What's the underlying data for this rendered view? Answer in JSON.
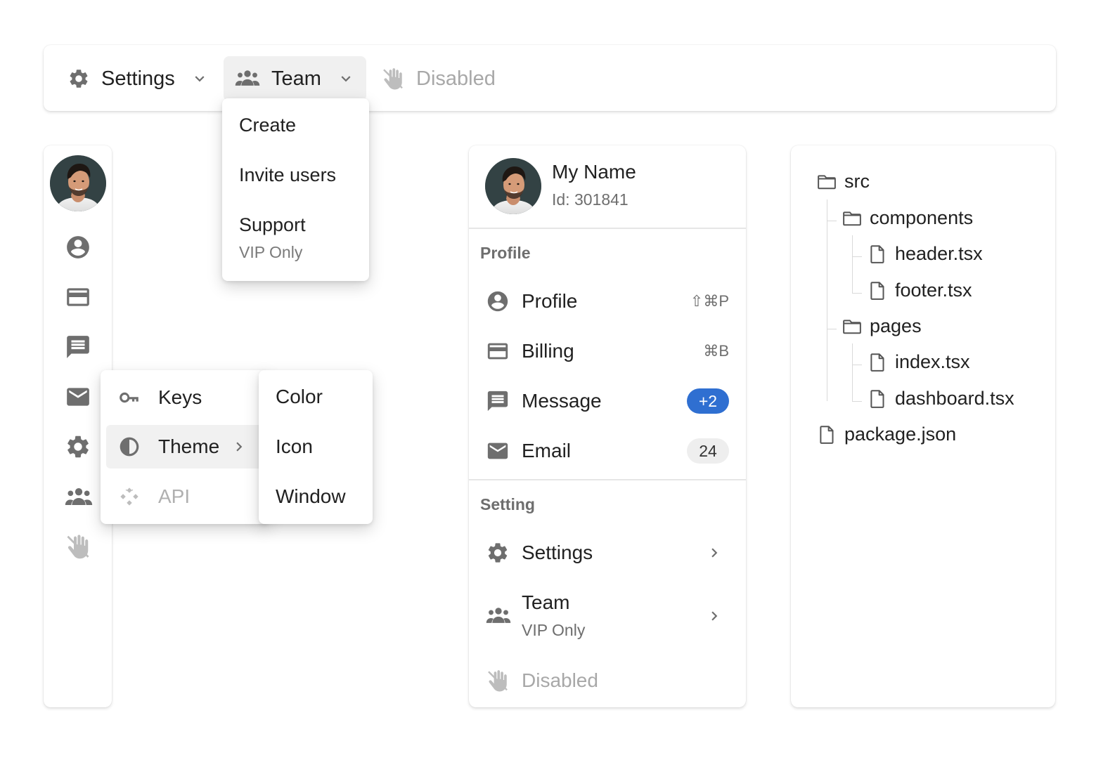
{
  "menubar": {
    "settings_label": "Settings",
    "team_label": "Team",
    "disabled_label": "Disabled"
  },
  "team_menu": {
    "items": [
      {
        "label": "Create"
      },
      {
        "label": "Invite users"
      },
      {
        "label": "Support",
        "sublabel": "VIP Only"
      }
    ]
  },
  "rail": {
    "icons": [
      "avatar",
      "account-circle-icon",
      "credit-card-icon",
      "message-icon",
      "mail-icon",
      "gear-icon",
      "team-icon",
      "disabled-hand-icon"
    ]
  },
  "keys_menu": {
    "items": [
      {
        "label": "Keys",
        "icon": "key-icon"
      },
      {
        "label": "Theme",
        "icon": "contrast-icon"
      },
      {
        "label": "API",
        "icon": "api-icon",
        "disabled": true
      }
    ],
    "theme_submenu": [
      "Color",
      "Icon",
      "Window"
    ]
  },
  "user": {
    "name": "My Name",
    "id_text": "Id: 301841"
  },
  "profile_section": {
    "title": "Profile",
    "items": [
      {
        "label": "Profile",
        "shortcut": "⇧⌘P"
      },
      {
        "label": "Billing",
        "shortcut": "⌘B"
      },
      {
        "label": "Message",
        "badge": "+2",
        "badge_color": "#2f6fd1"
      },
      {
        "label": "Email",
        "badge": "24",
        "badge_color": "#eeeeee"
      }
    ]
  },
  "setting_section": {
    "title": "Setting",
    "items": [
      {
        "label": "Settings"
      },
      {
        "label": "Team",
        "sublabel": "VIP Only"
      },
      {
        "label": "Disabled",
        "disabled": true
      }
    ]
  },
  "file_tree": {
    "root": "src",
    "components": "components",
    "header": "header.tsx",
    "footer": "footer.tsx",
    "pages": "pages",
    "index": "index.tsx",
    "dashboard": "dashboard.tsx",
    "package": "package.json"
  },
  "colors": {
    "accent": "#2f6fd1",
    "icon": "#6e6e6e",
    "disabled": "#a8a8a8"
  }
}
